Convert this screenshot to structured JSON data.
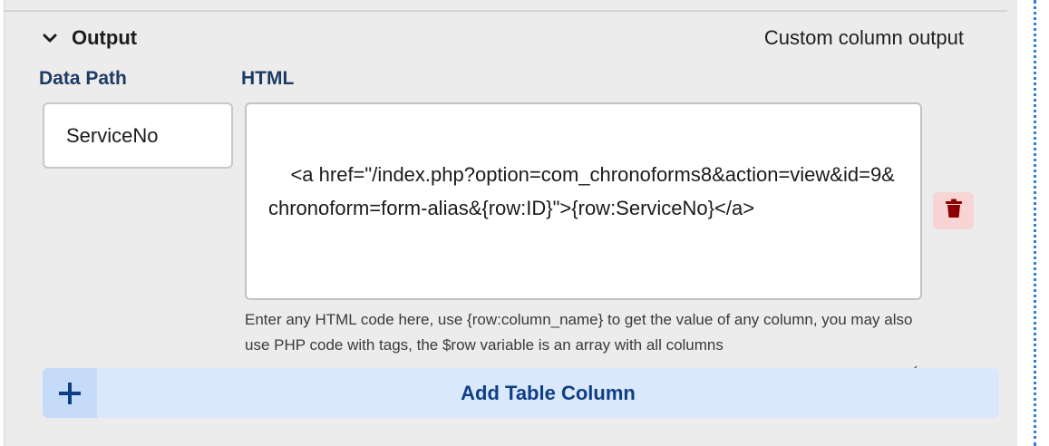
{
  "section": {
    "title": "Output",
    "note": "Custom column output",
    "expanded_icon": "chevron-down-icon"
  },
  "fields": {
    "data_path_label": "Data Path",
    "data_path_value": "ServiceNo",
    "html_label": "HTML",
    "html_value": "<a href=\"/index.php?option=com_chronoforms8&action=view&id=9&chronoform=form-alias&{row:ID}\">{row:ServiceNo}</a>",
    "help_text": "Enter any HTML code here, use {row:column_name} to get the value of any column, you may also use PHP code with tags, the $row variable is an array with all columns"
  },
  "actions": {
    "delete_icon": "trash-icon",
    "add_icon": "plus-icon",
    "add_label": "Add Table Column"
  },
  "colors": {
    "panel_bg": "#ececec",
    "label_navy": "#1d3a63",
    "add_bar_bg": "#dbe8fb",
    "add_label": "#0e3f86",
    "delete_bg": "#f9d4d4",
    "delete_icon": "#8b0000",
    "dashed_border": "#2f7fd9"
  }
}
